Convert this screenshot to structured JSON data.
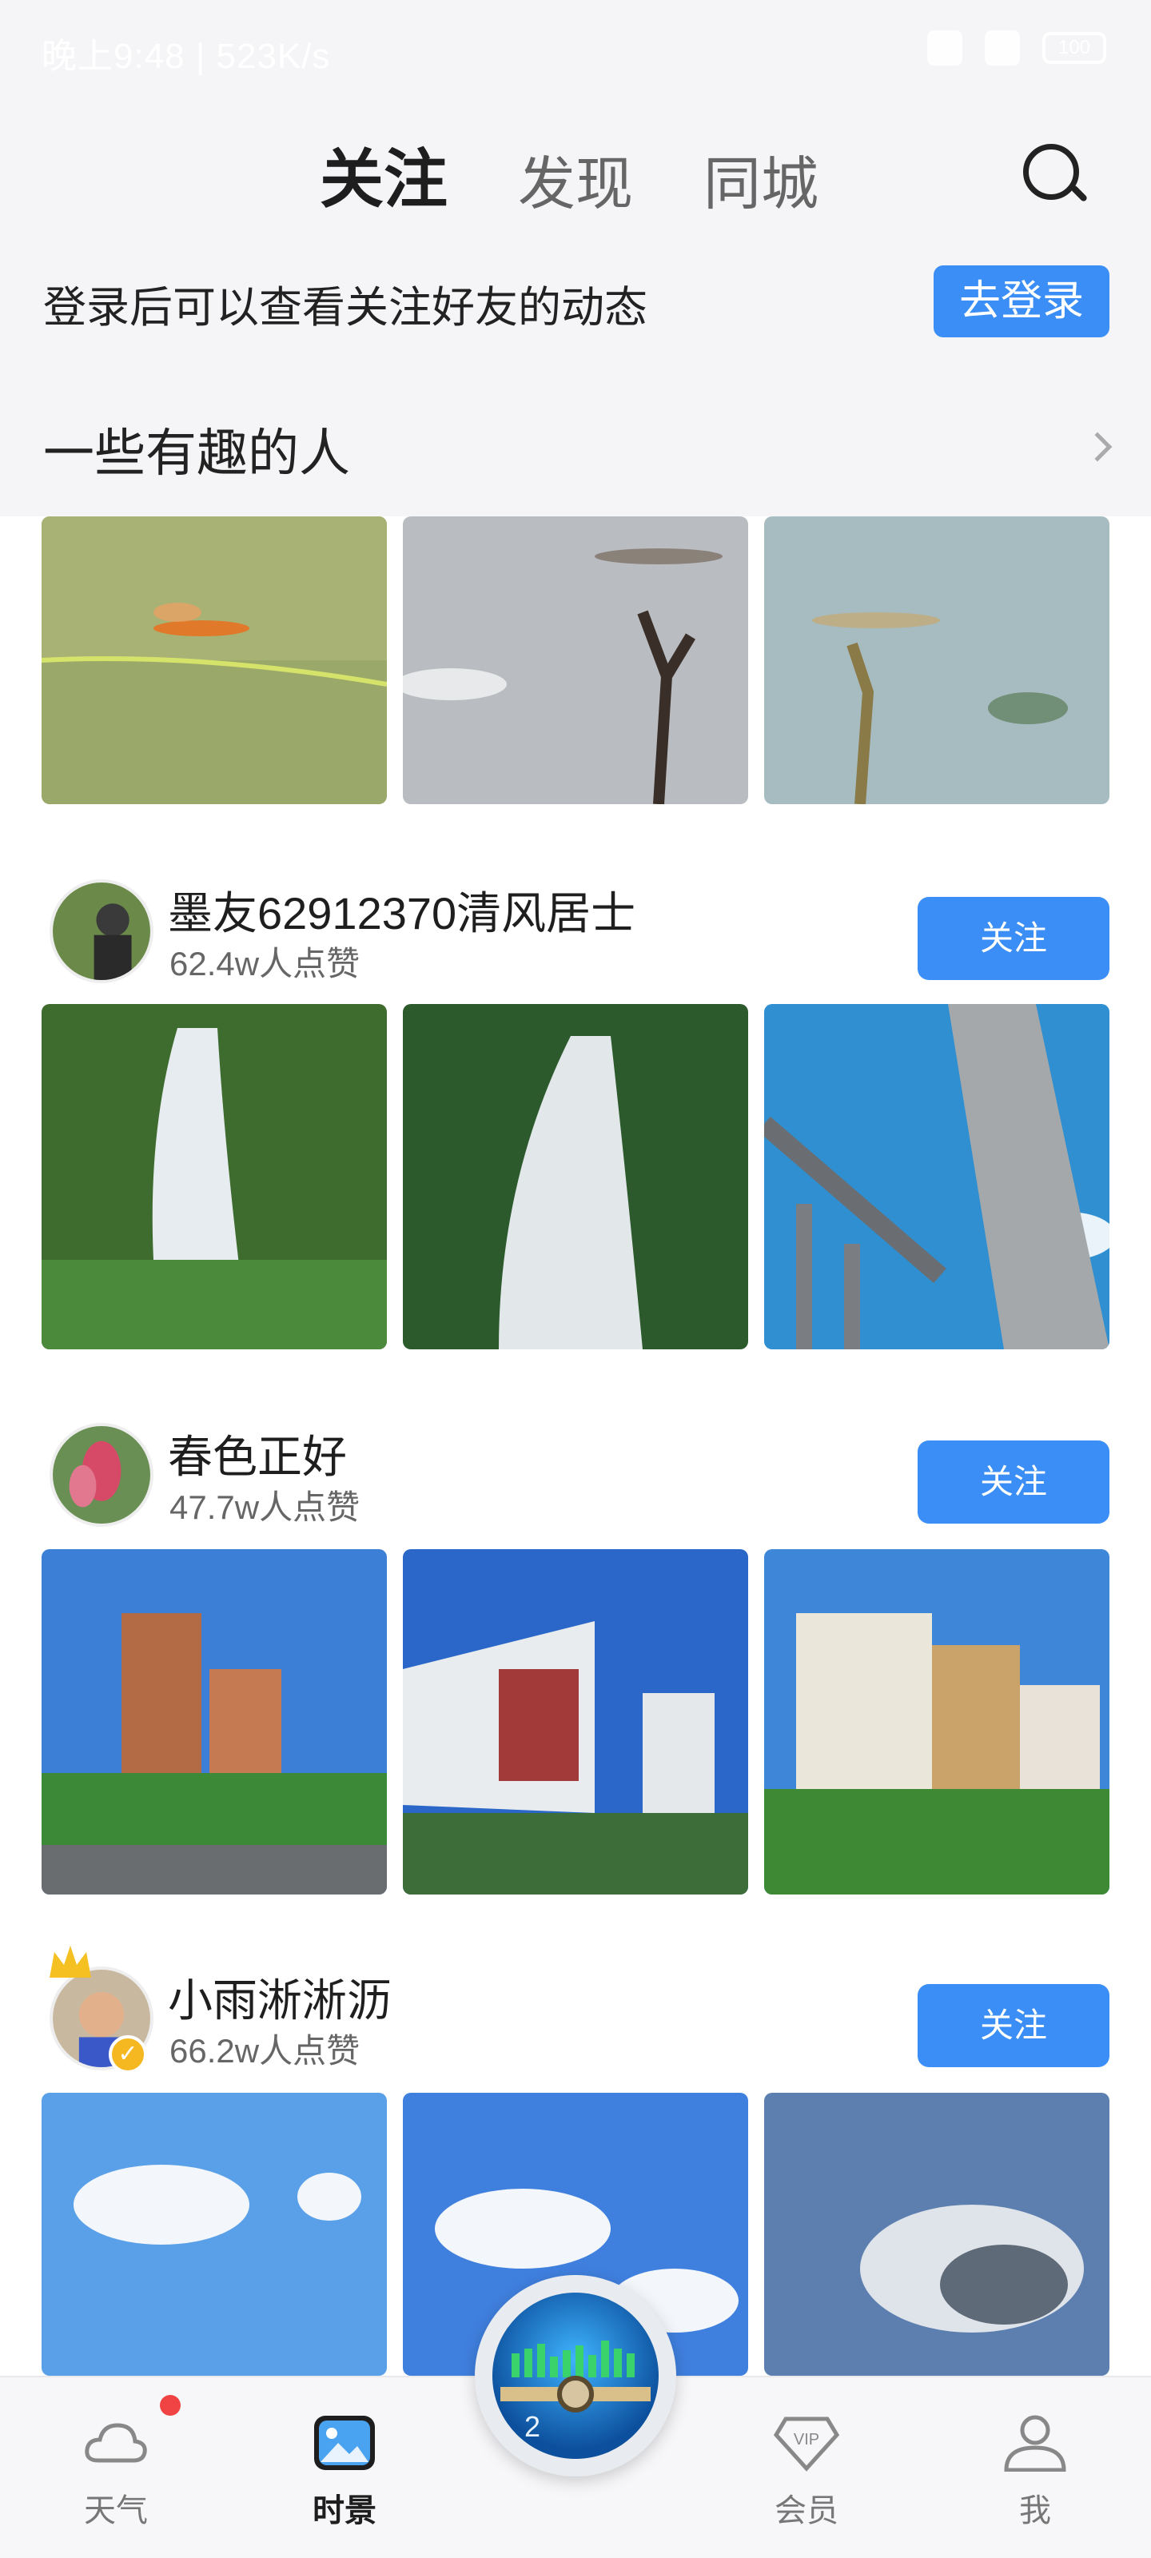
{
  "status_bar": {
    "time_text": "晚上9:48 | 523K/s",
    "battery": "100"
  },
  "tabs": [
    {
      "label": "关注",
      "active": true
    },
    {
      "label": "发现",
      "active": false
    },
    {
      "label": "同城",
      "active": false
    }
  ],
  "login_bar": {
    "text": "登录后可以查看关注好友的动态",
    "button": "去登录"
  },
  "section": {
    "title": "一些有趣的人"
  },
  "creators": [
    {
      "name": "墨友62912370清风居士",
      "likes": "62.4w人点赞",
      "follow": "关注"
    },
    {
      "name": "春色正好",
      "likes": "47.7w人点赞",
      "follow": "关注"
    },
    {
      "name": "小雨淅淅沥",
      "likes": "66.2w人点赞",
      "follow": "关注"
    }
  ],
  "nav": [
    {
      "label": "天气",
      "icon": "cloud-icon"
    },
    {
      "label": "时景",
      "icon": "picture-icon",
      "active": true
    },
    {
      "label": "会员",
      "icon": "vip-icon"
    },
    {
      "label": "我",
      "icon": "person-icon"
    }
  ],
  "fab": {
    "label": "2"
  },
  "colors": {
    "accent": "#3a8ef5",
    "header_bg": "#f5f5f7",
    "badge_red": "#f04343"
  }
}
